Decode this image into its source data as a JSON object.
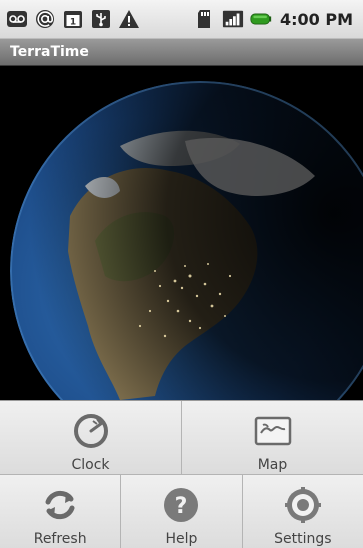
{
  "status_bar": {
    "time": "4:00 PM",
    "left_icons": [
      "voicemail-icon",
      "at-sign-icon",
      "calendar-icon",
      "usb-icon",
      "warning-icon"
    ],
    "right_icons": [
      "sd-card-icon",
      "signal-icon",
      "battery-icon"
    ]
  },
  "app": {
    "title": "TerraTime"
  },
  "menu": {
    "row1": [
      {
        "label": "Clock",
        "icon": "clock-icon"
      },
      {
        "label": "Map",
        "icon": "map-icon"
      }
    ],
    "row2": [
      {
        "label": "Refresh",
        "icon": "refresh-icon"
      },
      {
        "label": "Help",
        "icon": "help-icon"
      },
      {
        "label": "Settings",
        "icon": "settings-icon"
      }
    ]
  }
}
